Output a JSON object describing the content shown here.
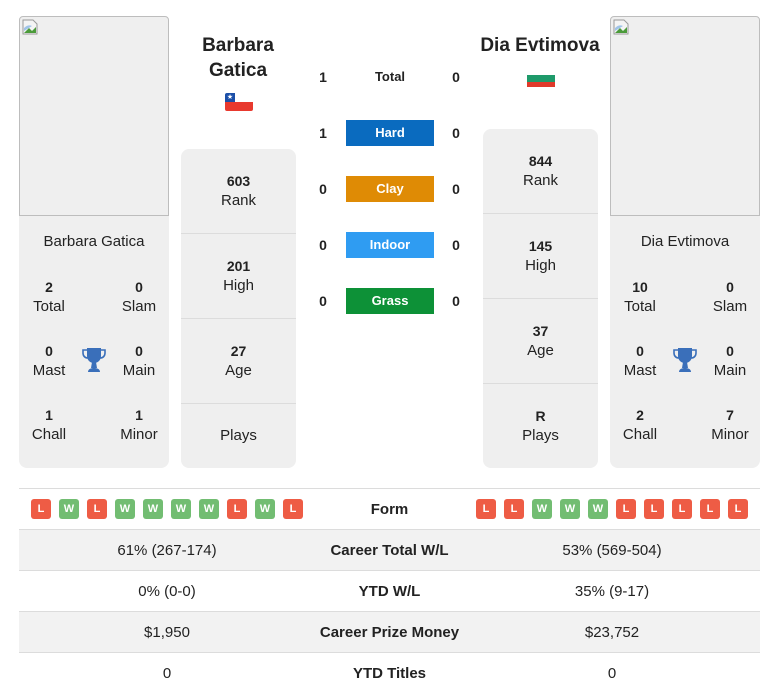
{
  "players": [
    {
      "name": "Barbara Gatica",
      "name_line1": "Barbara",
      "name_line2": "Gatica",
      "country_flag": "chile-flag",
      "photo": "broken-image-icon",
      "titles": {
        "total": "2",
        "total_label": "Total",
        "slam": "0",
        "slam_label": "Slam",
        "mast": "0",
        "mast_label": "Mast",
        "main": "0",
        "main_label": "Main",
        "chall": "1",
        "chall_label": "Chall",
        "minor": "1",
        "minor_label": "Minor"
      },
      "info": {
        "rank": "603",
        "rank_label": "Rank",
        "high": "201",
        "high_label": "High",
        "age": "27",
        "age_label": "Age",
        "plays": "",
        "plays_label": "Plays"
      },
      "form": [
        "L",
        "W",
        "L",
        "W",
        "W",
        "W",
        "W",
        "L",
        "W",
        "L"
      ],
      "career_wl": "61% (267-174)",
      "ytd_wl": "0% (0-0)",
      "prize_money": "$1,950",
      "ytd_titles": "0"
    },
    {
      "name": "Dia Evtimova",
      "name_line1": "Dia Evtimova",
      "country_flag": "bulgaria-flag",
      "photo": "broken-image-icon",
      "titles": {
        "total": "10",
        "total_label": "Total",
        "slam": "0",
        "slam_label": "Slam",
        "mast": "0",
        "mast_label": "Mast",
        "main": "0",
        "main_label": "Main",
        "chall": "2",
        "chall_label": "Chall",
        "minor": "7",
        "minor_label": "Minor"
      },
      "info": {
        "rank": "844",
        "rank_label": "Rank",
        "high": "145",
        "high_label": "High",
        "age": "37",
        "age_label": "Age",
        "plays": "R",
        "plays_label": "Plays"
      },
      "form": [
        "L",
        "L",
        "W",
        "W",
        "W",
        "L",
        "L",
        "L",
        "L",
        "L"
      ],
      "career_wl": "53% (569-504)",
      "ytd_wl": "35% (9-17)",
      "prize_money": "$23,752",
      "ytd_titles": "0"
    }
  ],
  "h2h": [
    {
      "label": "Total",
      "p1": "1",
      "p2": "0",
      "color": null
    },
    {
      "label": "Hard",
      "p1": "1",
      "p2": "0",
      "color": "#0a6bbf"
    },
    {
      "label": "Clay",
      "p1": "0",
      "p2": "0",
      "color": "#df8b05"
    },
    {
      "label": "Indoor",
      "p1": "0",
      "p2": "0",
      "color": "#2f9cf2"
    },
    {
      "label": "Grass",
      "p1": "0",
      "p2": "0",
      "color": "#0d9137"
    }
  ],
  "stats_labels": {
    "form": "Form",
    "career_wl": "Career Total W/L",
    "ytd_wl": "YTD W/L",
    "prize_money": "Career Prize Money",
    "ytd_titles": "YTD Titles"
  },
  "colors": {
    "loss": "#ee5c45",
    "win": "#72bd72",
    "trophy": "#3a6fba"
  }
}
